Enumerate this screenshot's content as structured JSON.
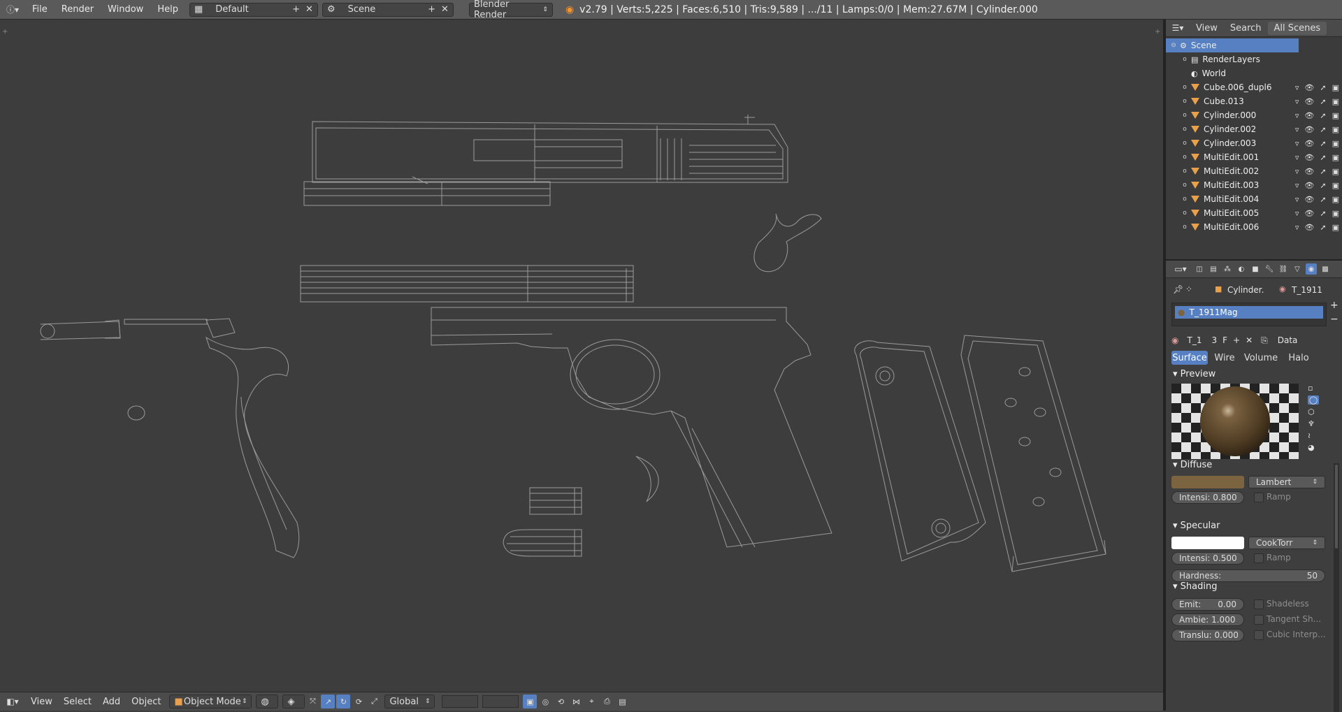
{
  "topbar": {
    "menus": [
      "File",
      "Render",
      "Window",
      "Help"
    ],
    "screen_layout": "Default",
    "scene": "Scene",
    "render_engine": "Blender Render",
    "stats": "v2.79 | Verts:5,225 | Faces:6,510 | Tris:9,589 | .../11 | Lamps:0/0 | Mem:27.67M | Cylinder.000"
  },
  "bottombar": {
    "menus": [
      "View",
      "Select",
      "Add",
      "Object"
    ],
    "mode": "Object Mode",
    "orientation": "Global"
  },
  "outliner": {
    "tabs": [
      "View",
      "Search",
      "All Scenes"
    ],
    "rows": [
      {
        "label": "Scene",
        "type": "scene"
      },
      {
        "label": "RenderLayers",
        "type": "renderlayers"
      },
      {
        "label": "World",
        "type": "world"
      },
      {
        "label": "Cube.006_dupl6",
        "type": "mesh"
      },
      {
        "label": "Cube.013",
        "type": "mesh"
      },
      {
        "label": "Cylinder.000",
        "type": "mesh"
      },
      {
        "label": "Cylinder.002",
        "type": "mesh"
      },
      {
        "label": "Cylinder.003",
        "type": "mesh"
      },
      {
        "label": "MultiEdit.001",
        "type": "mesh"
      },
      {
        "label": "MultiEdit.002",
        "type": "mesh"
      },
      {
        "label": "MultiEdit.003",
        "type": "mesh"
      },
      {
        "label": "MultiEdit.004",
        "type": "mesh"
      },
      {
        "label": "MultiEdit.005",
        "type": "mesh"
      },
      {
        "label": "MultiEdit.006",
        "type": "mesh"
      }
    ]
  },
  "properties": {
    "breadcrumb_object": "Cylinder.",
    "breadcrumb_material": "T_1911",
    "material_slot": "T_1911Mag",
    "datablock": {
      "name": "T_1",
      "users": "3",
      "fake": "F",
      "link": "Data"
    },
    "tabs": [
      "Surface",
      "Wire",
      "Volume",
      "Halo"
    ],
    "preview": {
      "title": "Preview"
    },
    "diffuse": {
      "title": "Diffuse",
      "color": "#7d6440",
      "shader": "Lambert",
      "intensity_label": "Intensi:",
      "intensity": "0.800",
      "ramp": "Ramp"
    },
    "specular": {
      "title": "Specular",
      "color": "#ffffff",
      "shader": "CookTorr",
      "intensity_label": "Intensi:",
      "intensity": "0.500",
      "ramp": "Ramp",
      "hardness_label": "Hardness:",
      "hardness": "50"
    },
    "shading": {
      "title": "Shading",
      "emit_label": "Emit:",
      "emit": "0.00",
      "ambient_label": "Ambie:",
      "ambient": "1.000",
      "translucency_label": "Translu:",
      "translucency": "0.000",
      "shadeless": "Shadeless",
      "tangent": "Tangent Sh...",
      "cubic": "Cubic Interp..."
    }
  },
  "colors": {
    "accent": "#5680c2",
    "mesh_icon": "#e9a04a",
    "wire": "#9a9a9a"
  }
}
